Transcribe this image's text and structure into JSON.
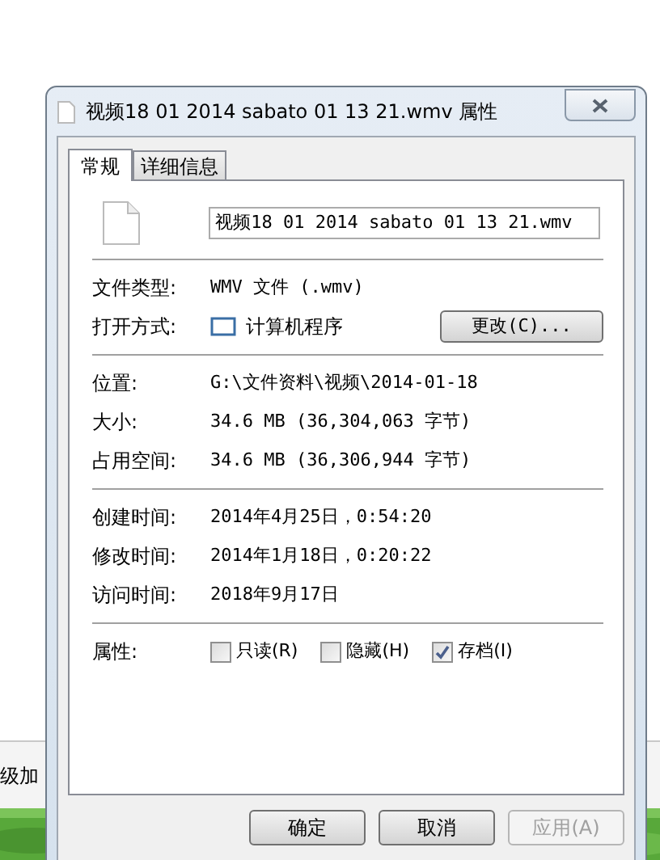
{
  "background": {
    "text": "级加"
  },
  "window": {
    "title": "视频18 01 2014 sabato 01 13 21.wmv 属性",
    "tabs": [
      {
        "label": "常规",
        "selected": true
      },
      {
        "label": "详细信息",
        "selected": false
      }
    ],
    "file_name": "视频18 01 2014 sabato 01 13 21.wmv",
    "sections": [
      {
        "rows": [
          {
            "kind": "text",
            "label": "文件类型:",
            "value": "WMV 文件 (.wmv)"
          },
          {
            "kind": "app",
            "label": "打开方式:",
            "value": "计算机程序",
            "button": "更改(C)..."
          }
        ]
      },
      {
        "rows": [
          {
            "kind": "text",
            "label": "位置:",
            "value": "G:\\文件资料\\视频\\2014-01-18"
          },
          {
            "kind": "text",
            "label": "大小:",
            "value": "34.6 MB (36,304,063 字节)"
          },
          {
            "kind": "text",
            "label": "占用空间:",
            "value": "34.6 MB (36,306,944 字节)"
          }
        ]
      },
      {
        "rows": [
          {
            "kind": "text",
            "label": "创建时间:",
            "value": "2014年4月25日，0:54:20"
          },
          {
            "kind": "text",
            "label": "修改时间:",
            "value": "2014年1月18日，0:20:22"
          },
          {
            "kind": "text",
            "label": "访问时间:",
            "value": "2018年9月17日"
          }
        ]
      }
    ],
    "attributes": {
      "label": "属性:",
      "checkboxes": [
        {
          "label": "只读(R)",
          "checked": false
        },
        {
          "label": "隐藏(H)",
          "checked": false
        },
        {
          "label": "存档(I)",
          "checked": true
        }
      ]
    },
    "buttons": [
      {
        "label": "确定",
        "disabled": false
      },
      {
        "label": "取消",
        "disabled": false
      },
      {
        "label": "应用(A)",
        "disabled": true
      }
    ]
  }
}
